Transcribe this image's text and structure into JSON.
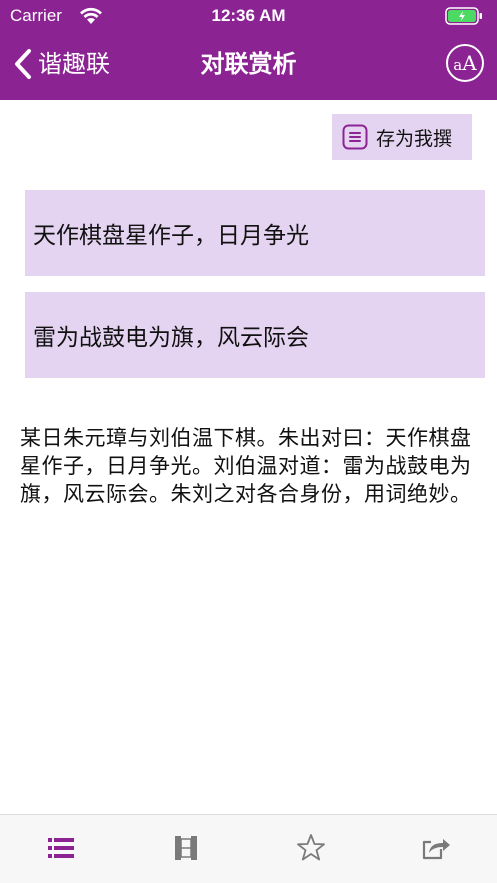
{
  "status_bar": {
    "carrier": "Carrier",
    "time": "12:36 AM"
  },
  "nav": {
    "back_label": "谐趣联",
    "title": "对联赏析",
    "font_button_icon": "font-size-icon"
  },
  "actions": {
    "save_label": "存为我撰",
    "save_icon": "note-icon"
  },
  "couplet": {
    "first_line": "天作棋盘星作子，日月争光",
    "second_line": "雷为战鼓电为旗，风云际会"
  },
  "description": "某日朱元璋与刘伯温下棋。朱出对曰：天作棋盘星作子，日月争光。刘伯温对道：雷为战鼓电为旗，风云际会。朱刘之对各合身份，用词绝妙。",
  "tabbar": {
    "items": [
      {
        "icon": "list-icon",
        "active": true
      },
      {
        "icon": "book-icon",
        "active": false
      },
      {
        "icon": "star-icon",
        "active": false
      },
      {
        "icon": "share-icon",
        "active": false
      }
    ]
  },
  "colors": {
    "brand": "#8b2393",
    "highlight": "#e4d4f1",
    "tab_active": "#8b2393",
    "tab_inactive": "#7a7a7a"
  }
}
